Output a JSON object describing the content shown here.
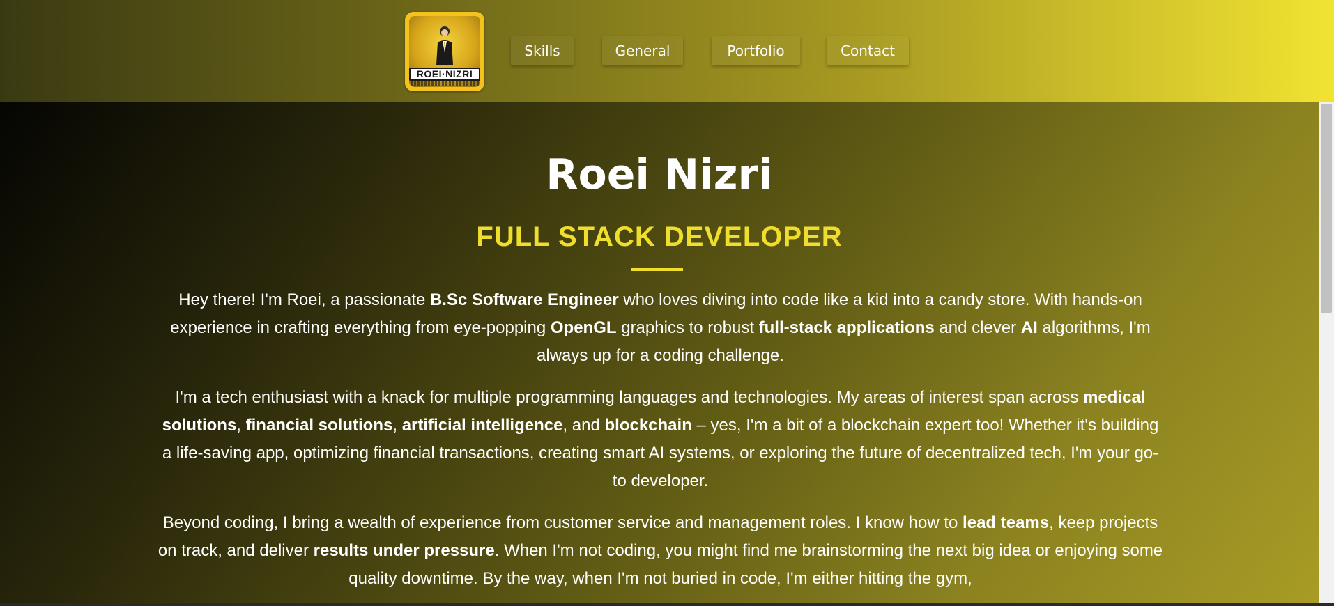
{
  "header": {
    "logo": {
      "text": "ROEI·NIZRI",
      "alt": "Roei Nizri logo"
    },
    "nav": [
      {
        "label": "Skills"
      },
      {
        "label": "General"
      },
      {
        "label": "Portfolio"
      },
      {
        "label": "Contact"
      }
    ]
  },
  "hero": {
    "name": "Roei Nizri",
    "role": "FULL STACK DEVELOPER"
  },
  "about": {
    "p1": [
      {
        "t": "Hey there! I'm Roei, a passionate "
      },
      {
        "b": "B.Sc Software Engineer"
      },
      {
        "t": " who loves diving into code like a kid into a candy store. With hands-on experience in crafting everything from eye-popping "
      },
      {
        "b": "OpenGL"
      },
      {
        "t": " graphics to robust "
      },
      {
        "b": "full-stack applications"
      },
      {
        "t": " and clever "
      },
      {
        "b": "AI"
      },
      {
        "t": " algorithms, I'm always up for a coding challenge."
      }
    ],
    "p2": [
      {
        "t": "I'm a tech enthusiast with a knack for multiple programming languages and technologies. My areas of interest span across "
      },
      {
        "b": "medical solutions"
      },
      {
        "t": ", "
      },
      {
        "b": "financial solutions"
      },
      {
        "t": ", "
      },
      {
        "b": "artificial intelligence"
      },
      {
        "t": ", and "
      },
      {
        "b": "blockchain"
      },
      {
        "t": " – yes, I'm a bit of a blockchain expert too! Whether it's building a life-saving app, optimizing financial transactions, creating smart AI systems, or exploring the future of decentralized tech, I'm your go-to developer."
      }
    ],
    "p3": [
      {
        "t": "Beyond coding, I bring a wealth of experience from customer service and management roles. I know how to "
      },
      {
        "b": "lead teams"
      },
      {
        "t": ", keep projects on track, and deliver "
      },
      {
        "b": "results under pressure"
      },
      {
        "t": ". When I'm not coding, you might find me brainstorming the next big idea or enjoying some quality downtime. By the way, when I'm not buried in code, I'm either hitting the gym,"
      }
    ]
  },
  "colors": {
    "accent": "#f0de2c",
    "header_end": "#f2e332",
    "text": "#ffffff"
  }
}
